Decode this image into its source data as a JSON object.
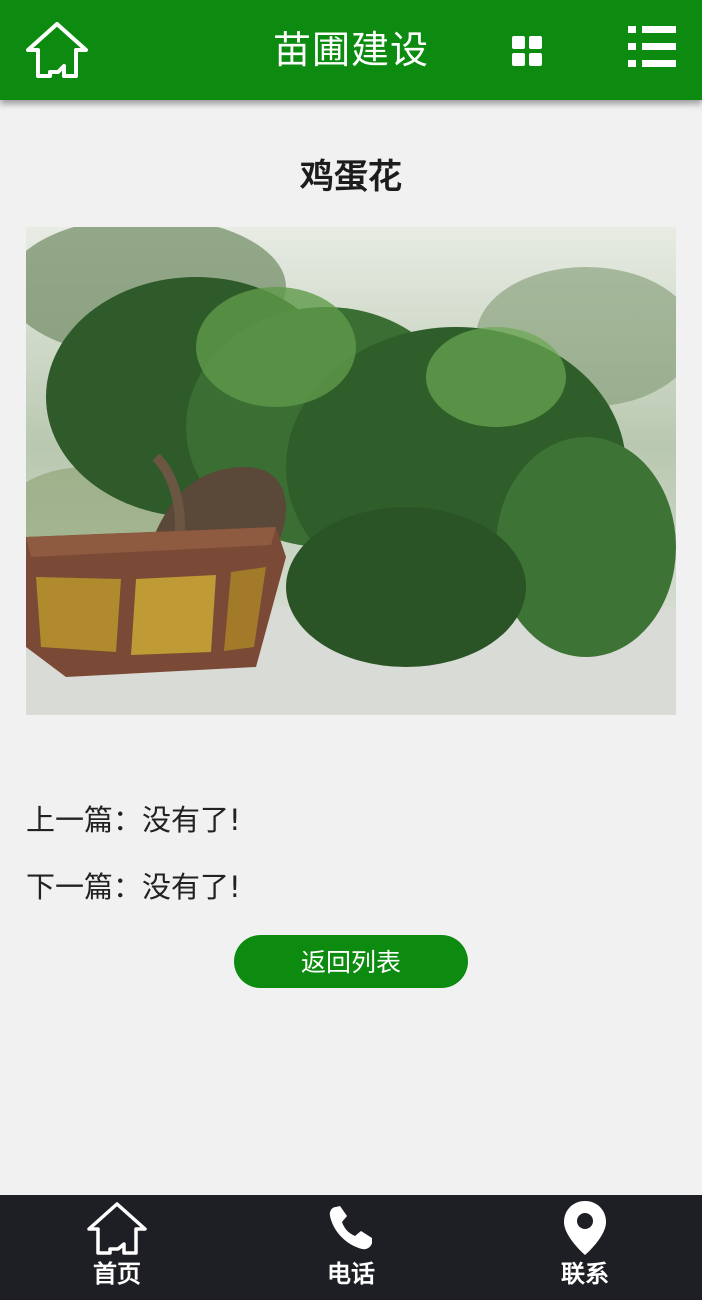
{
  "header": {
    "site_title": "苗圃建设",
    "home_icon": "home-icon",
    "grid_icon": "grid-icon",
    "menu_icon": "menu-list-icon",
    "background_color": "#0c8b10"
  },
  "article": {
    "title": "鸡蛋花",
    "image_subject": "bonsai tree in hexagonal pot",
    "prev_label": "上一篇：没有了!",
    "next_label": "下一篇：没有了!",
    "back_button_label": "返回列表"
  },
  "bottom_nav": {
    "items": [
      {
        "label": "首页",
        "icon": "home-icon"
      },
      {
        "label": "电话",
        "icon": "phone-icon"
      },
      {
        "label": "联系",
        "icon": "location-pin-icon"
      }
    ],
    "background_color": "#1e1f24"
  }
}
